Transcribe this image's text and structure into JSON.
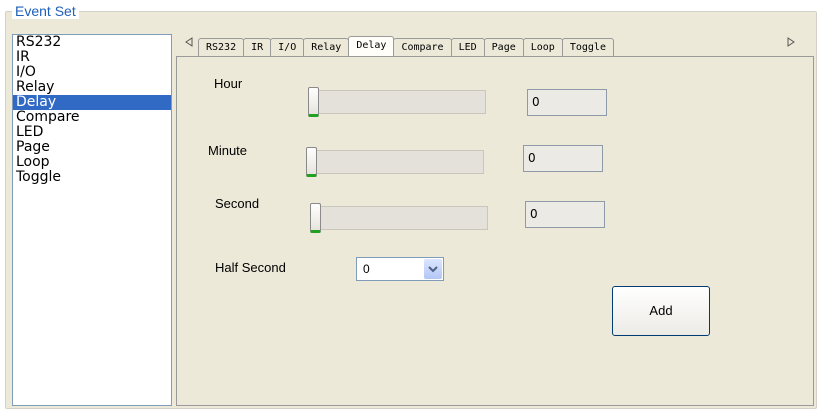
{
  "group": {
    "title": "Event Set"
  },
  "list": {
    "items": [
      "RS232",
      "IR",
      "I/O",
      "Relay",
      "Delay",
      "Compare",
      "LED",
      "Page",
      "Loop",
      "Toggle"
    ],
    "selected": 4
  },
  "tabs": {
    "items": [
      "RS232",
      "IR",
      "I/O",
      "Relay",
      "Delay",
      "Compare",
      "LED",
      "Page",
      "Loop",
      "Toggle"
    ],
    "active": 4,
    "scroll_left_icon": "triangle-left-icon",
    "scroll_right_icon": "triangle-right-icon"
  },
  "delay": {
    "hour": {
      "label": "Hour",
      "value": "0"
    },
    "minute": {
      "label": "Minute",
      "value": "0"
    },
    "second": {
      "label": "Second",
      "value": "0"
    },
    "half_second": {
      "label": "Half Second",
      "value": "0"
    },
    "add_label": "Add"
  },
  "colors": {
    "accent": "#1f5fb9",
    "selection": "#316ac5",
    "slider_thumb_base": "#21a121"
  }
}
